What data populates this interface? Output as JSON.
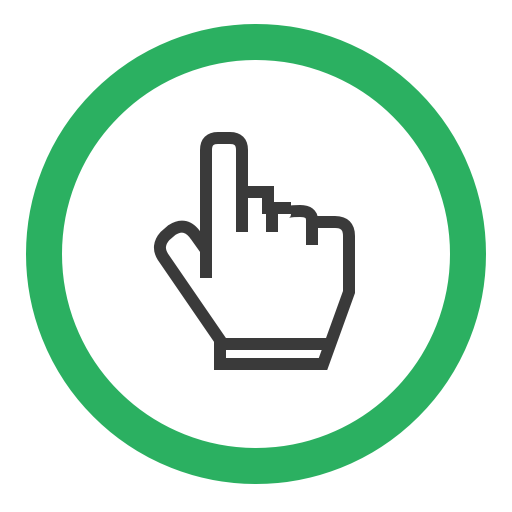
{
  "icon": {
    "name": "pointing-hand-icon",
    "ring_color": "#2bb061",
    "stroke_color": "#3a3a3a",
    "fill_color": "#ffffff"
  }
}
